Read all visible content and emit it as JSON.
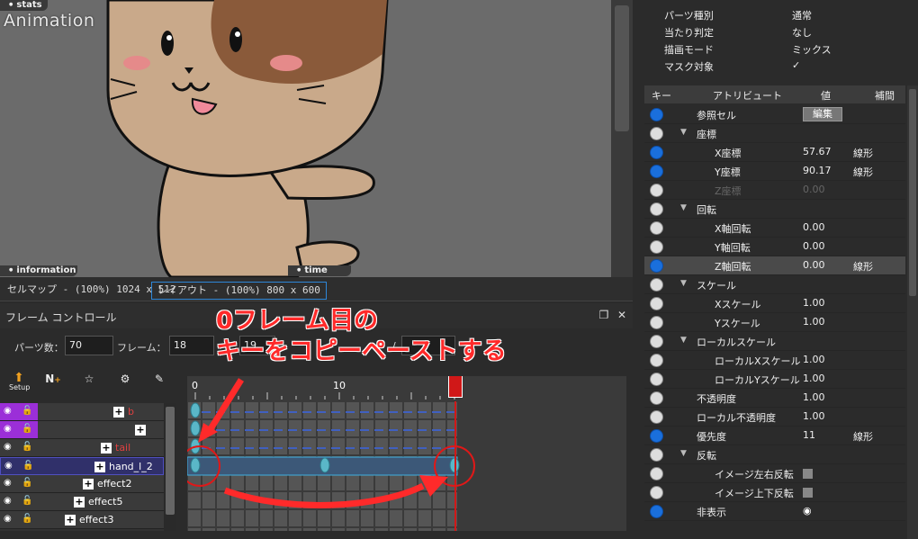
{
  "viewport": {
    "tab_stats": "stats",
    "title": "Animation",
    "tab_information": "information",
    "tab_time": "time"
  },
  "map_tabs": {
    "cellmap": "セルマップ - (100%) 1024 x 512",
    "layout": "レイアウト - (100%) 800 x 600"
  },
  "frame_control": {
    "title": "フレーム コントロール",
    "parts_label": "パーツ数：",
    "parts_value": "70",
    "frame_label": "フレーム：",
    "frame_value": "18",
    "frame_next": "19",
    "slash": "/"
  },
  "toolbar": {
    "setup": "Setup",
    "n_tool": "N"
  },
  "layers": [
    {
      "name": "b",
      "indent": 126
    },
    {
      "name": "",
      "indent": 150
    },
    {
      "name": "tail",
      "indent": 112
    },
    {
      "name": "hand_l_2",
      "indent": 104
    },
    {
      "name": "effect2",
      "indent": 92
    },
    {
      "name": "effect5",
      "indent": 82
    },
    {
      "name": "effect3",
      "indent": 72
    }
  ],
  "timeline": {
    "ruler_0": "0",
    "ruler_10": "10"
  },
  "annotation": {
    "line1": "0フレーム目の",
    "line2": "キーをコピーペーストする"
  },
  "properties": [
    {
      "key": "パーツ種別",
      "value": "通常"
    },
    {
      "key": "当たり判定",
      "value": "なし"
    },
    {
      "key": "描画モード",
      "value": "ミックス"
    },
    {
      "key": "マスク対象",
      "value": "✓"
    }
  ],
  "attr_header": {
    "key": "キー",
    "attr": "アトリビュート",
    "value": "値",
    "interp": "補間"
  },
  "attributes": [
    {
      "name": "参照セル",
      "value": "",
      "interp": "",
      "key": "blue",
      "indent": 58,
      "button": "編集"
    },
    {
      "name": "座標",
      "value": "",
      "interp": "",
      "key": "grey",
      "indent": 58,
      "tri": true
    },
    {
      "name": "X座標",
      "value": "57.67",
      "interp": "線形",
      "key": "blue",
      "indent": 78
    },
    {
      "name": "Y座標",
      "value": "90.17",
      "interp": "線形",
      "key": "blue",
      "indent": 78
    },
    {
      "name": "Z座標",
      "value": "0.00",
      "interp": "",
      "key": "grey",
      "indent": 78,
      "dim": true
    },
    {
      "name": "回転",
      "value": "",
      "interp": "",
      "key": "grey",
      "indent": 58,
      "tri": true
    },
    {
      "name": "X軸回転",
      "value": "0.00",
      "interp": "",
      "key": "grey",
      "indent": 78
    },
    {
      "name": "Y軸回転",
      "value": "0.00",
      "interp": "",
      "key": "grey",
      "indent": 78
    },
    {
      "name": "Z軸回転",
      "value": "0.00",
      "interp": "線形",
      "key": "blue",
      "indent": 78,
      "hl": true
    },
    {
      "name": "スケール",
      "value": "",
      "interp": "",
      "key": "grey",
      "indent": 58,
      "tri": true
    },
    {
      "name": "Xスケール",
      "value": "1.00",
      "interp": "",
      "key": "grey",
      "indent": 78
    },
    {
      "name": "Yスケール",
      "value": "1.00",
      "interp": "",
      "key": "grey",
      "indent": 78
    },
    {
      "name": "ローカルスケール",
      "value": "",
      "interp": "",
      "key": "grey",
      "indent": 58,
      "tri": true
    },
    {
      "name": "ローカルXスケール",
      "value": "1.00",
      "interp": "",
      "key": "grey",
      "indent": 78
    },
    {
      "name": "ローカルYスケール",
      "value": "1.00",
      "interp": "",
      "key": "grey",
      "indent": 78
    },
    {
      "name": "不透明度",
      "value": "1.00",
      "interp": "",
      "key": "grey",
      "indent": 58
    },
    {
      "name": "ローカル不透明度",
      "value": "1.00",
      "interp": "",
      "key": "grey",
      "indent": 58
    },
    {
      "name": "優先度",
      "value": "11",
      "interp": "線形",
      "key": "blue",
      "indent": 58
    },
    {
      "name": "反転",
      "value": "",
      "interp": "",
      "key": "grey",
      "indent": 58,
      "tri": true
    },
    {
      "name": "イメージ左右反転",
      "value": "",
      "interp": "",
      "key": "grey",
      "indent": 78,
      "check": true
    },
    {
      "name": "イメージ上下反転",
      "value": "",
      "interp": "",
      "key": "grey",
      "indent": 78,
      "check": true
    },
    {
      "name": "非表示",
      "value": "",
      "interp": "",
      "key": "blue",
      "indent": 58,
      "eye": true
    }
  ]
}
